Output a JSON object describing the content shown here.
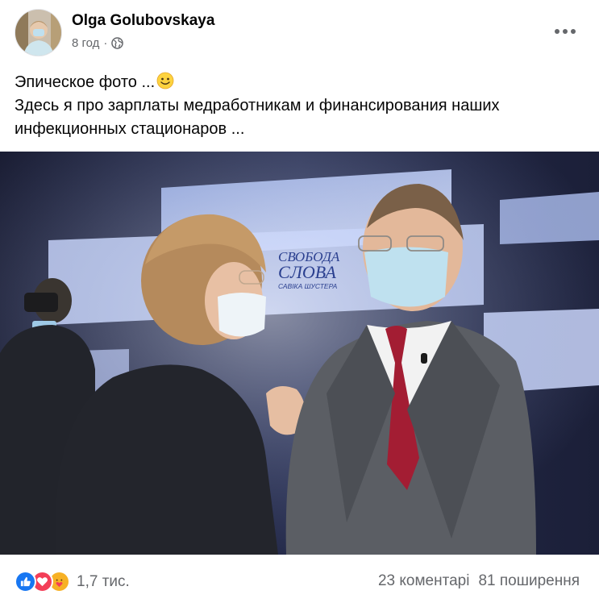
{
  "post": {
    "author": "Olga Golubovskaya",
    "time": "8 год",
    "separator": "·",
    "privacy_icon": "globe-icon",
    "more_icon": "more-options-icon",
    "text_lines": [
      "Эпическое фото ...",
      "Здесь я про зарплаты медработникам и финансирования наших",
      "инфекционных стационаров ..."
    ],
    "emoji": "slightly-smiling-face",
    "photo": {
      "logo_line1": "СВОБОДА",
      "logo_line2": "СЛОВА",
      "logo_line3": "САВІКА ШУСТЕРА"
    }
  },
  "footer": {
    "reaction_icons": [
      "like-icon",
      "love-icon",
      "care-icon"
    ],
    "reaction_colors": {
      "like": "#1877f2",
      "love": "#f33e58",
      "care": "#f7b125"
    },
    "reactions_count": "1,7 тис.",
    "comments": "23 коментарі",
    "shares": "81 поширення"
  },
  "colors": {
    "secondary_text": "#65676b",
    "primary_text": "#050505"
  }
}
